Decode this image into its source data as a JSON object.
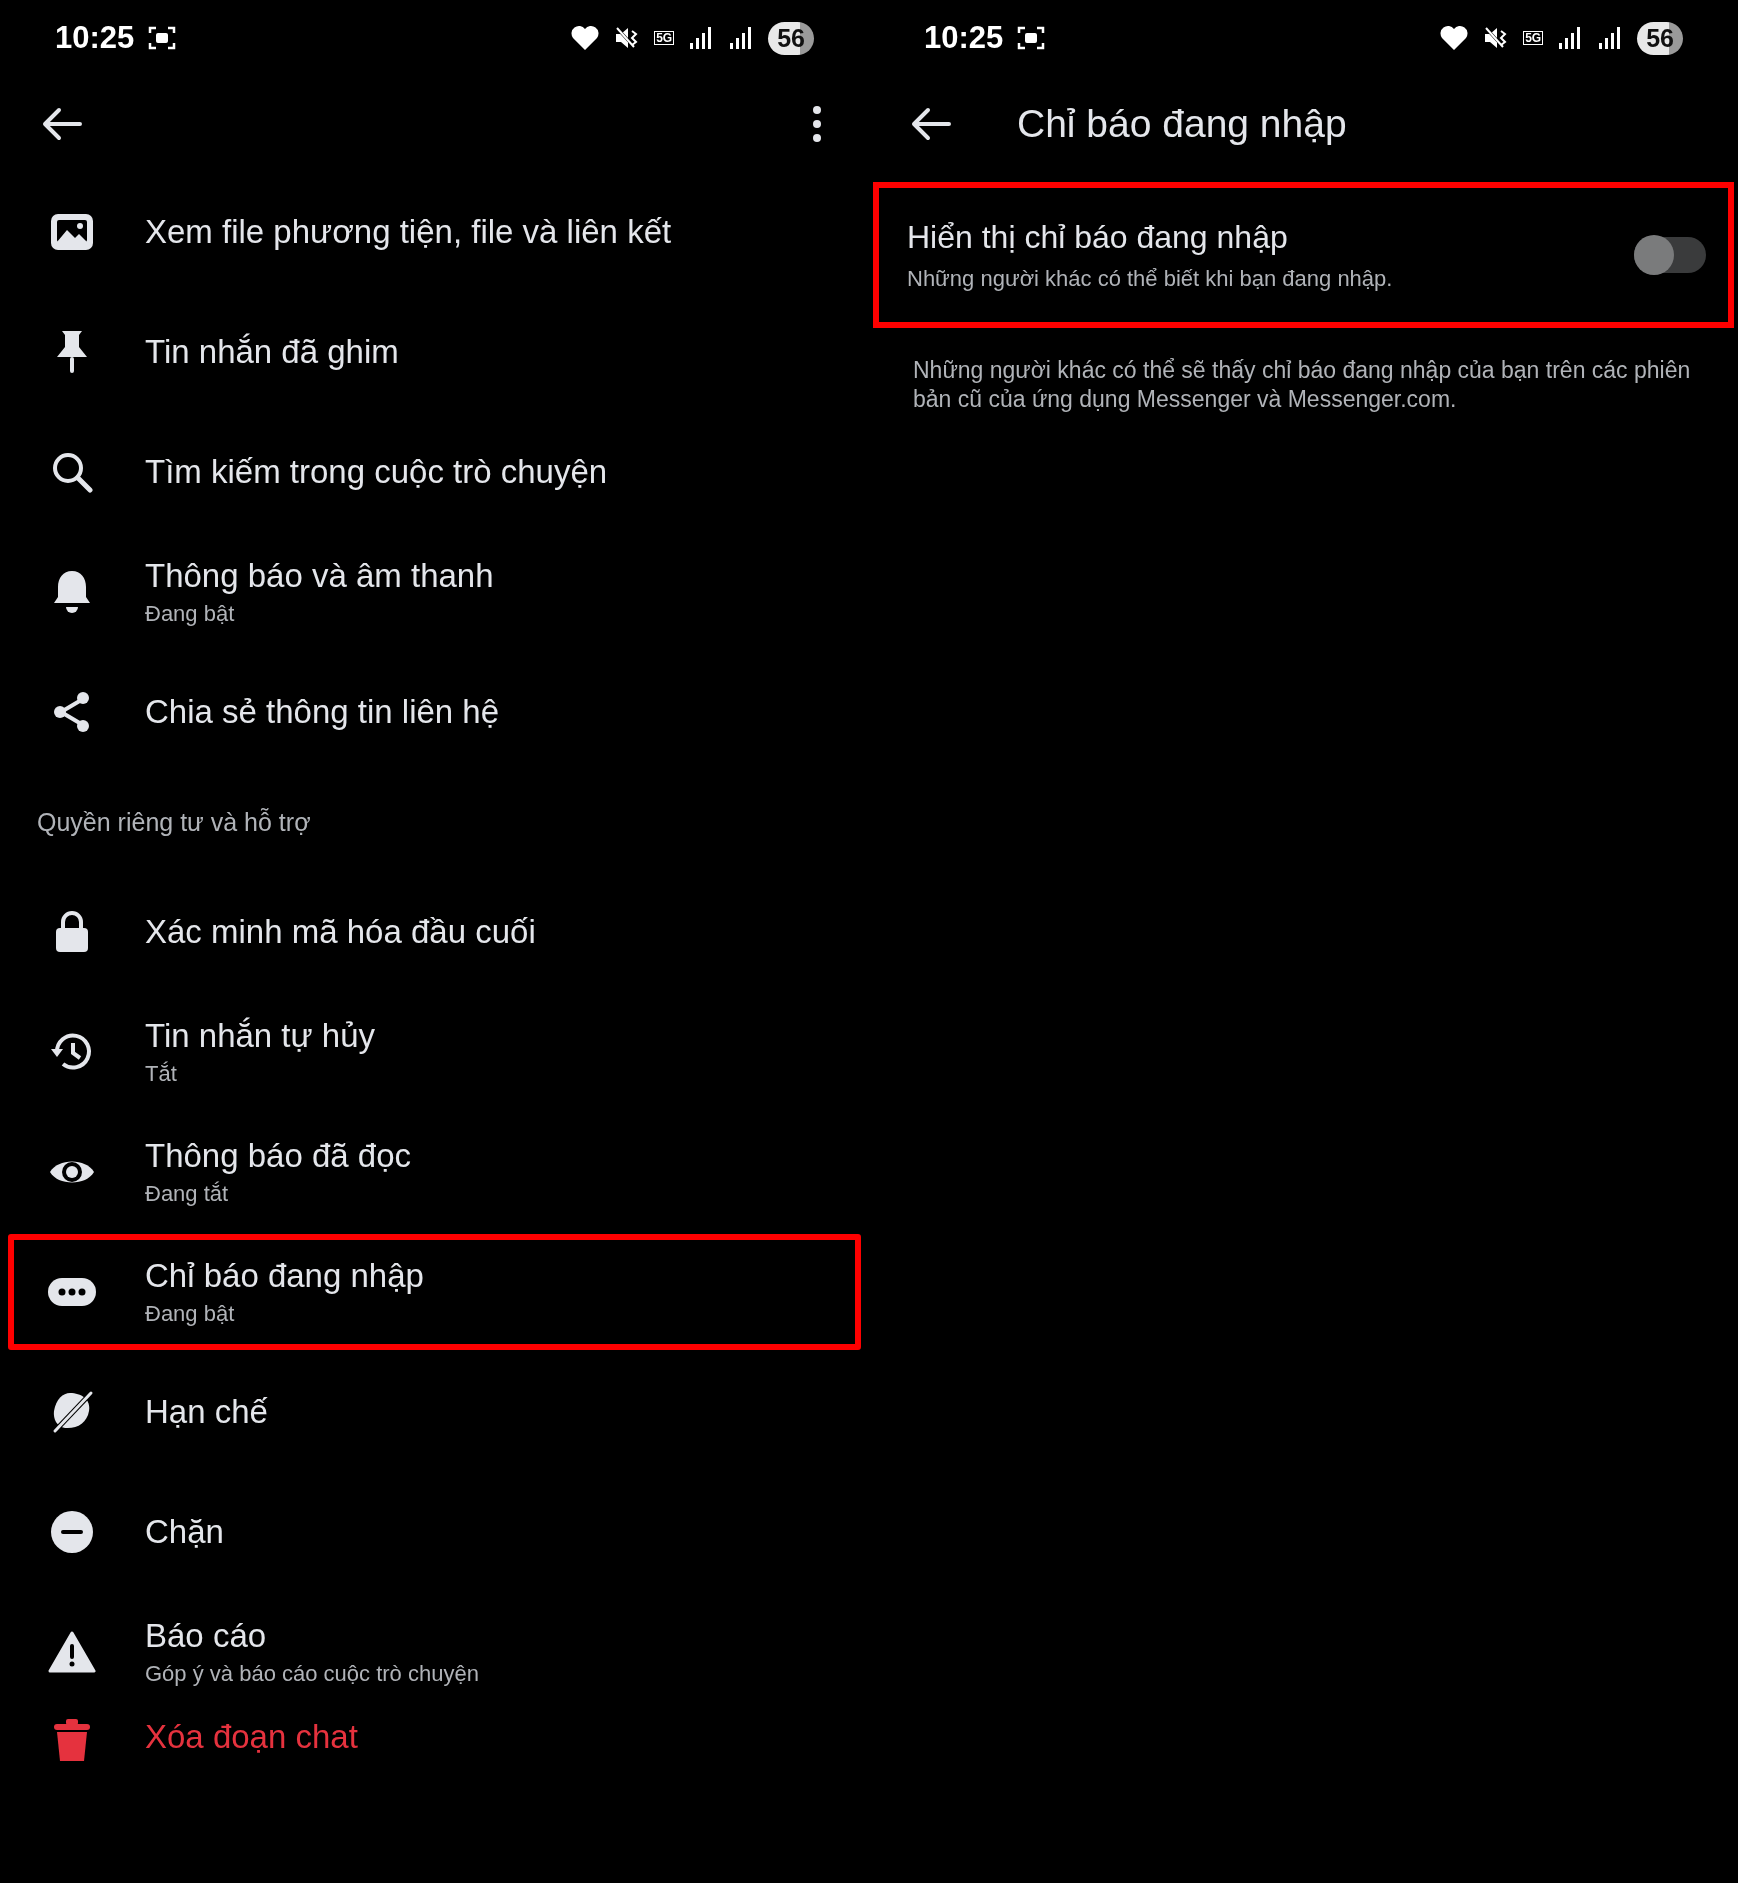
{
  "left_screen": {
    "status_bar": {
      "time": "10:25",
      "network": "5G",
      "battery": "56"
    },
    "items": [
      {
        "kind": "option",
        "title": "Xem file phương tiện, file và liên kết",
        "highlighted": false
      },
      {
        "kind": "option",
        "title": "Tin nhắn đã ghim",
        "highlighted": false
      },
      {
        "kind": "option",
        "title": "Tìm kiếm trong cuộc trò chuyện",
        "highlighted": false
      },
      {
        "kind": "option",
        "title": "Thông báo và âm thanh",
        "subtitle": "Đang bật",
        "highlighted": false
      },
      {
        "kind": "option",
        "title": "Chia sẻ thông tin liên hệ",
        "highlighted": false
      },
      {
        "kind": "section",
        "title": "Quyền riêng tư và hỗ trợ"
      },
      {
        "kind": "option",
        "title": "Xác minh mã hóa đầu cuối",
        "highlighted": false
      },
      {
        "kind": "option",
        "title": "Tin nhắn tự hủy",
        "subtitle": "Tắt",
        "highlighted": false
      },
      {
        "kind": "option",
        "title": "Thông báo đã đọc",
        "subtitle": "Đang tắt",
        "highlighted": false
      },
      {
        "kind": "option",
        "title": "Chỉ báo đang nhập",
        "subtitle": "Đang bật",
        "highlighted": true
      },
      {
        "kind": "option",
        "title": "Hạn chế",
        "highlighted": false
      },
      {
        "kind": "option",
        "title": "Chặn",
        "highlighted": false
      },
      {
        "kind": "option",
        "title": "Báo cáo",
        "subtitle": "Góp ý và báo cáo cuộc trò chuyện",
        "highlighted": false
      },
      {
        "kind": "destructive",
        "title": "Xóa đoạn chat",
        "highlighted": false
      }
    ]
  },
  "right_screen": {
    "status_bar": {
      "time": "10:25",
      "network": "5G",
      "battery": "56"
    },
    "title": "Chỉ báo đang nhập",
    "setting": {
      "title": "Hiển thị chỉ báo đang nhập",
      "subtitle": "Những người khác có thể biết khi bạn đang nhập.",
      "on": false,
      "highlighted": true
    },
    "note": "Những người khác có thể sẽ thấy chỉ báo đang nhập của bạn trên các phiên bản cũ của ứng dụng Messenger và Messenger.com."
  }
}
